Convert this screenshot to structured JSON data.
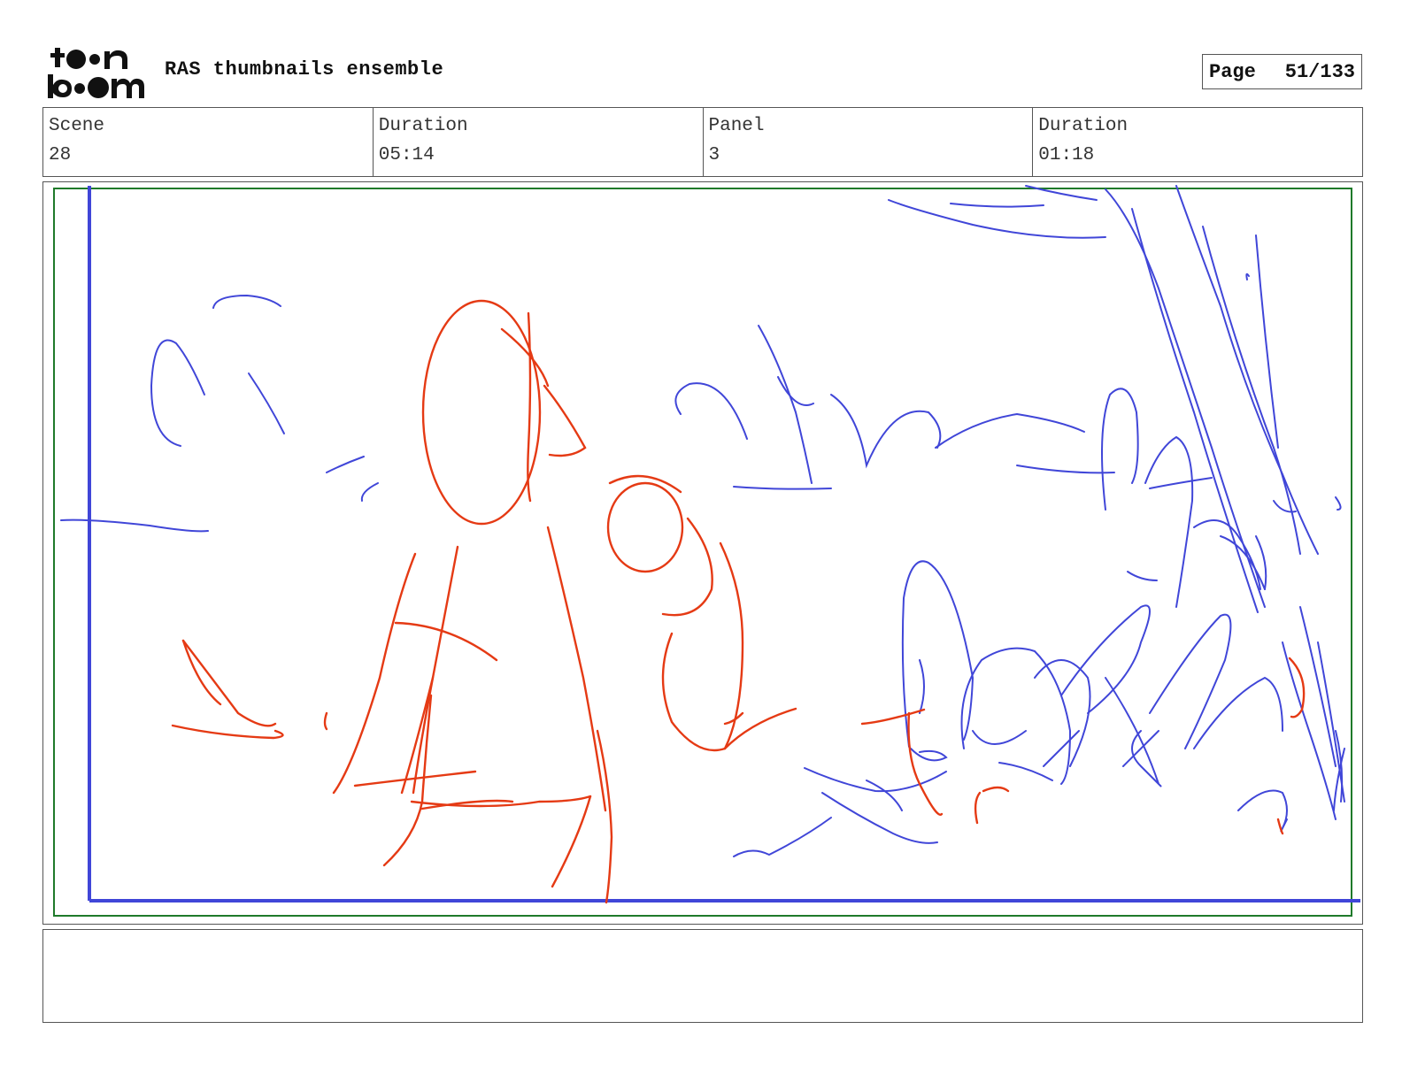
{
  "header": {
    "logo_text": "toon boom",
    "project_title": "RAS thumbnails ensemble",
    "page_label": "Page",
    "page_value": "51/133"
  },
  "info": {
    "scene_label": "Scene",
    "scene_value": "28",
    "scene_duration_label": "Duration",
    "scene_duration_value": "05:14",
    "panel_label": "Panel",
    "panel_value": "3",
    "panel_duration_label": "Duration",
    "panel_duration_value": "01:18"
  },
  "colors": {
    "sketch_blue": "#4046d8",
    "sketch_red": "#e53a14",
    "safe_frame": "#1f7a2a",
    "border": "#555555"
  },
  "notes": {
    "text": ""
  }
}
